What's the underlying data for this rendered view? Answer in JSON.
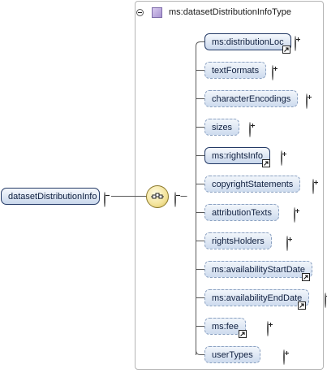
{
  "root": {
    "label": "datasetDistributionInfo"
  },
  "type_box": {
    "label": "ms:datasetDistributionInfoType"
  },
  "elements": [
    {
      "label": "ms:distributionLoc",
      "kind": "required",
      "ref": true
    },
    {
      "label": "textFormats",
      "kind": "optional",
      "ref": false
    },
    {
      "label": "characterEncodings",
      "kind": "optional",
      "ref": false
    },
    {
      "label": "sizes",
      "kind": "optional",
      "ref": false
    },
    {
      "label": "ms:rightsInfo",
      "kind": "required",
      "ref": true
    },
    {
      "label": "copyrightStatements",
      "kind": "optional",
      "ref": false
    },
    {
      "label": "attributionTexts",
      "kind": "optional",
      "ref": false
    },
    {
      "label": "rightsHolders",
      "kind": "optional",
      "ref": false
    },
    {
      "label": "ms:availabilityStartDate",
      "kind": "optional",
      "ref": true
    },
    {
      "label": "ms:availabilityEndDate",
      "kind": "optional",
      "ref": true
    },
    {
      "label": "ms:fee",
      "kind": "optional",
      "ref": true
    },
    {
      "label": "userTypes",
      "kind": "optional",
      "ref": false
    }
  ],
  "icons": {
    "collapse": "minus-circle-icon",
    "expand": "plus-circle-icon",
    "reference": "reference-arrow-icon",
    "sequence": "sequence-compositor-icon",
    "complex_type": "complex-type-icon"
  }
}
